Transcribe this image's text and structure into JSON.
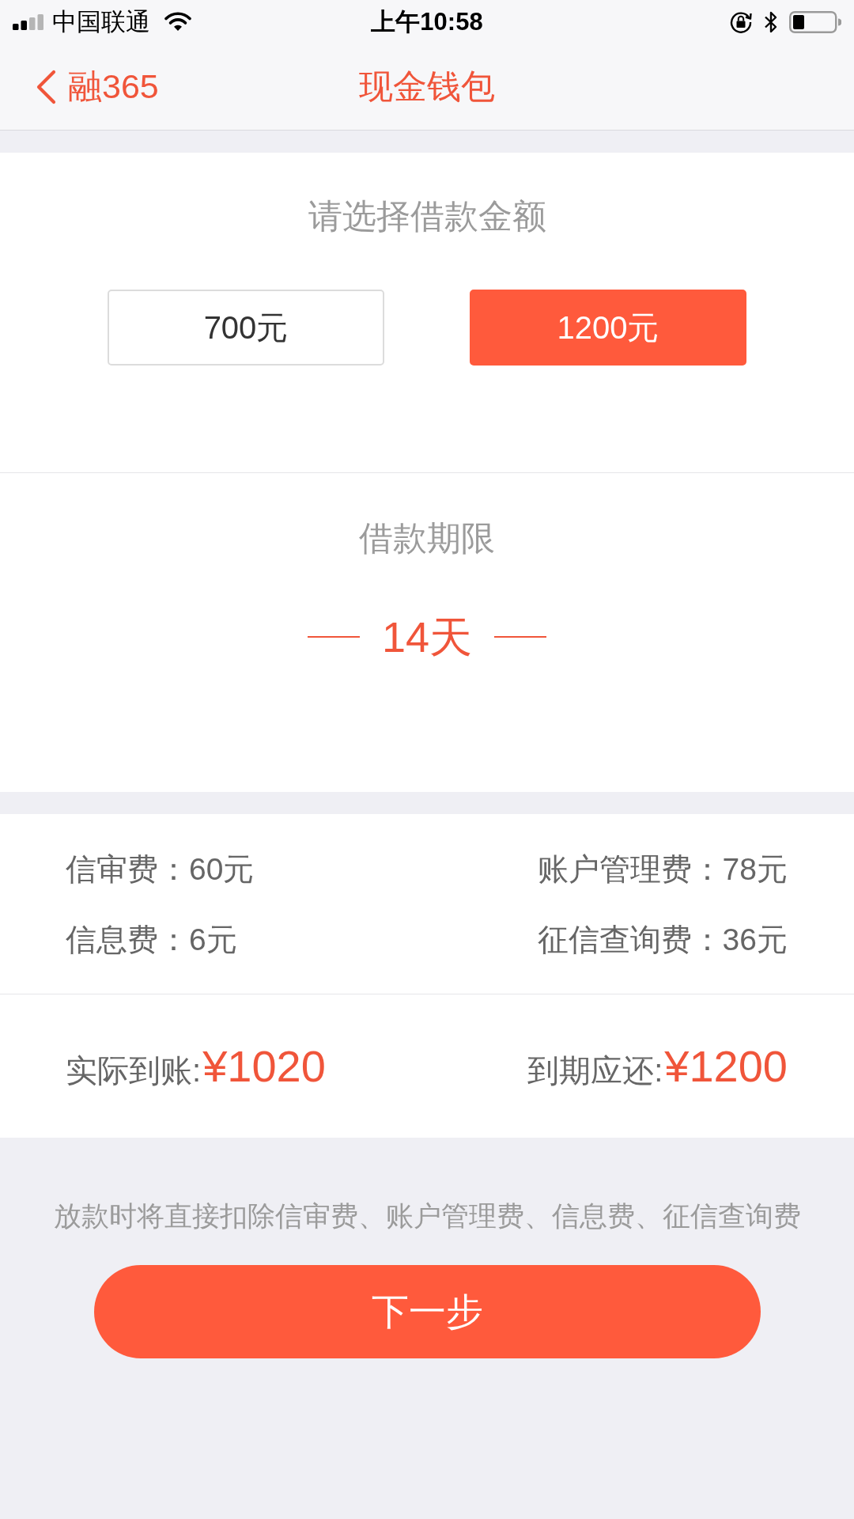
{
  "status_bar": {
    "carrier": "中国联通",
    "time": "上午10:58"
  },
  "nav_bar": {
    "back_label": "融365",
    "title": "现金钱包"
  },
  "amount_section": {
    "title": "请选择借款金额",
    "options": [
      {
        "label": "700元",
        "selected": false
      },
      {
        "label": "1200元",
        "selected": true
      }
    ]
  },
  "term_section": {
    "title": "借款期限",
    "value": "14天"
  },
  "fees": [
    "信审费：60元",
    "账户管理费：78元",
    "信息费：6元",
    "征信查询费：36元"
  ],
  "totals": [
    {
      "label": "实际到账:",
      "amount": "¥1020"
    },
    {
      "label": "到期应还:",
      "amount": "¥1200"
    }
  ],
  "note": "放款时将直接扣除信审费、账户管理费、信息费、征信查询费",
  "next_button": {
    "label": "下一步"
  }
}
